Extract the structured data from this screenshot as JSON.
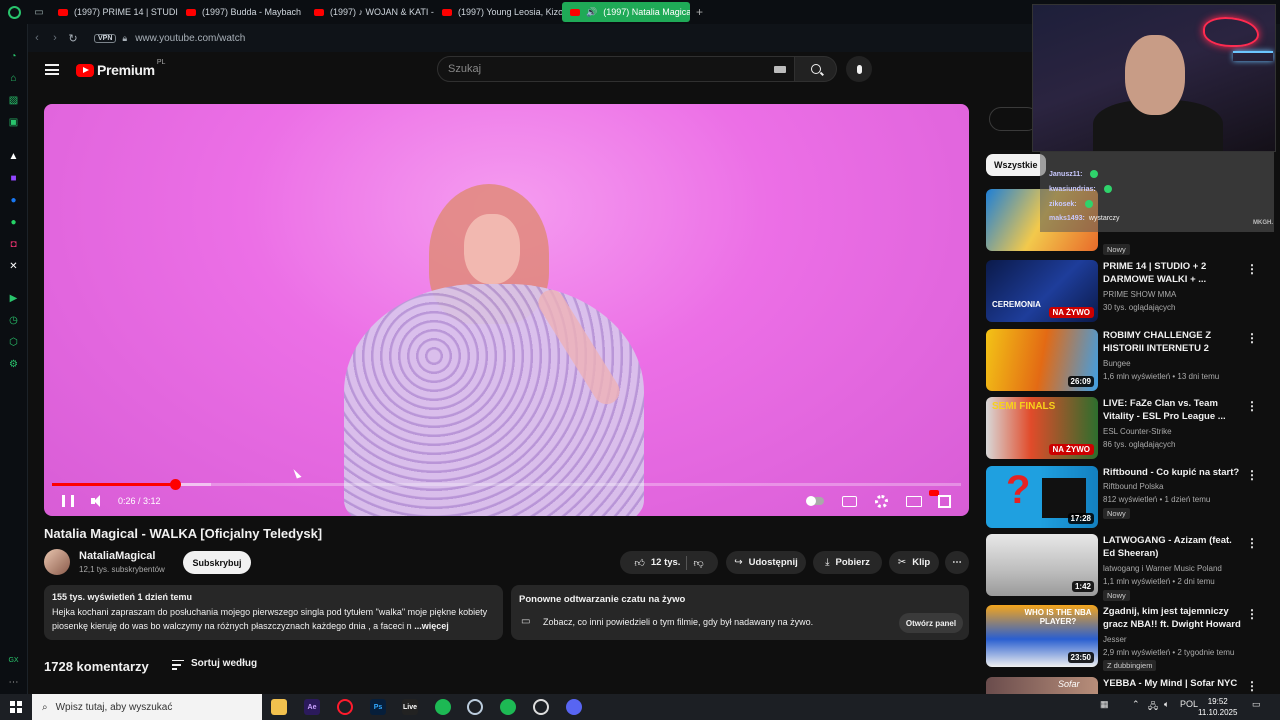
{
  "browser": {
    "tabs": [
      {
        "label": "(1997) PRIME 14 | STUDIO"
      },
      {
        "label": "(1997) Budda - Maybach"
      },
      {
        "label": "(1997) ♪ WOJAN & KATI -"
      },
      {
        "label": "(1997) Young Leosia, Kizo"
      },
      {
        "label": "(1997) Natalia Magical"
      }
    ],
    "vpn": "VPN",
    "url": "www.youtube.com/watch"
  },
  "youtube": {
    "logo_text": "Premium",
    "region": "PL",
    "search_placeholder": "Szukaj"
  },
  "player": {
    "time": "0:26 / 3:12",
    "progress_fraction": 0.135,
    "buffered_fraction": 0.175
  },
  "video": {
    "title": "Natalia Magical - WALKA [Oficjalny Teledysk]",
    "channel": "NataliaMagical",
    "subscribers": "12,1 tys. subskrybentów",
    "subscribe": "Subskrybuj",
    "likes": "12 tys.",
    "share": "Udostępnij",
    "download": "Pobierz",
    "clip": "Klip",
    "more": "⋯",
    "views_meta": "155 tys. wyświetleń  1 dzień temu",
    "description": "Hejka kochani zapraszam do posłuchania mojego pierwszego singla pod tytułem \"walka\" moje piękne kobiety piosenkę kieruję do was bo walczymy na różnych płaszczyznach każdego dnia , a faceci n",
    "more_link": "...więcej"
  },
  "chat_replay": {
    "title": "Ponowne odtwarzanie czatu na żywo",
    "text": "Zobacz, co inni powiedzieli o tym filmie, gdy był nadawany na żywo.",
    "button": "Otwórz panel"
  },
  "comments": {
    "count": "1728 komentarzy",
    "sort": "Sortuj według"
  },
  "sidebar_chip": "Wszystkie",
  "recommendations": [
    {
      "title": "",
      "channel": "",
      "views": "",
      "badge": "Nowy"
    },
    {
      "title": "PRIME 14 | STUDIO + 2 DARMOWE WALKI + ...",
      "channel": "PRIME SHOW MMA",
      "views": "30 tys. oglądających",
      "overlay": "NA ŻYWO",
      "thumb_text": "CEREMONIA"
    },
    {
      "title": "ROBIMY CHALLENGE Z HISTORII INTERNETU 2",
      "channel": "Bungee",
      "views": "1,6 mln wyświetleń • 13 dni temu",
      "overlay": "26:09"
    },
    {
      "title": "LIVE: FaZe Clan vs. Team Vitality - ESL Pro League ...",
      "channel": "ESL Counter-Strike",
      "views": "86 tys. oglądających",
      "overlay": "NA ŻYWO",
      "thumb_text": "SEMI FINALS"
    },
    {
      "title": "Riftbound - Co kupić na start?",
      "channel": "Riftbound Polska",
      "views": "812 wyświetleń • 1 dzień temu",
      "overlay": "17:28",
      "badge": "Nowy"
    },
    {
      "title": "LATWOGANG - Azizam (feat. Ed Sheeran)",
      "channel": "latwogang i Warner Music Poland",
      "views": "1,1 mln wyświetleń • 2 dni temu",
      "overlay": "1:42",
      "badge": "Nowy"
    },
    {
      "title": "Zgadnij, kim jest tajemniczy gracz NBA!! ft. Dwight Howard",
      "channel": "Jesser",
      "views": "2,9 mln wyświetleń • 2 tygodnie temu",
      "overlay": "23:50",
      "badge": "Z dubbingiem",
      "thumb_text": "WHO IS THE NBA PLAYER?"
    },
    {
      "title": "YEBBA - My Mind | Sofar NYC",
      "channel": "",
      "views": "",
      "thumb_text": "Sofar"
    }
  ],
  "stream_chat": [
    {
      "nick": "Janusz11:",
      "msg": ""
    },
    {
      "nick": "kwasiundrias:",
      "msg": ""
    },
    {
      "nick": "zikosek:",
      "msg": ""
    },
    {
      "nick": "maks1493:",
      "msg": "wystarczy"
    }
  ],
  "stream_watermark": "MKGH.",
  "taskbar": {
    "search_placeholder": "Wpisz tutaj, aby wyszukać",
    "lang": "POL",
    "time": "19:52",
    "date": "11.10.2025"
  },
  "colors": {
    "accent_green": "#1faa57",
    "yt_red": "#ff0000",
    "bg": "#0f0f0f"
  }
}
